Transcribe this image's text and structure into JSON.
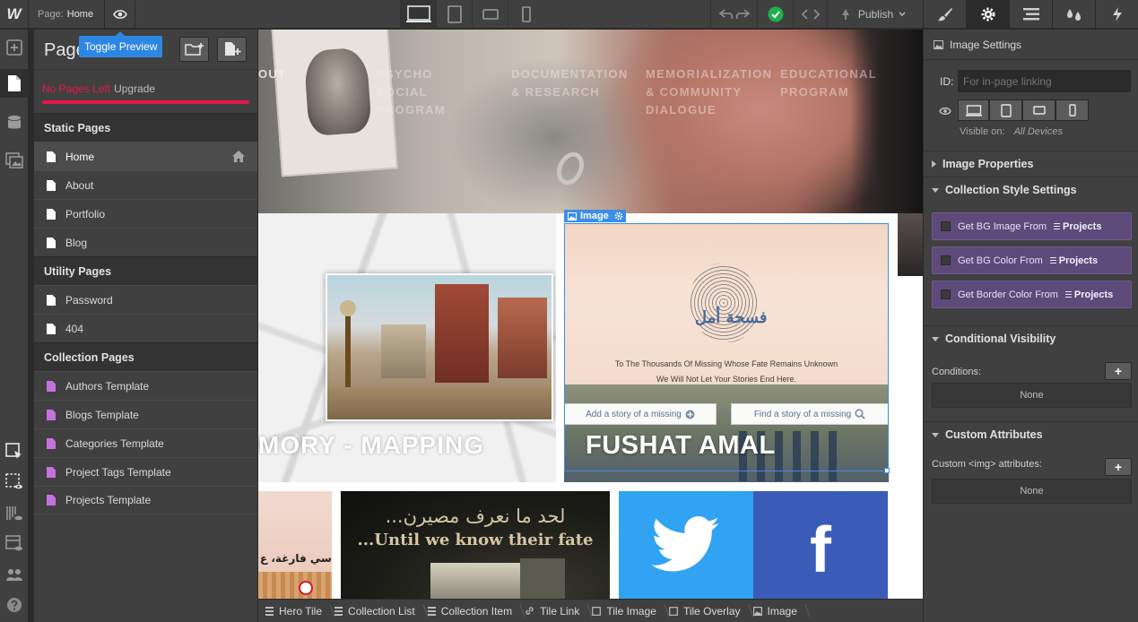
{
  "app": {
    "logo": "W",
    "page_label": "Page:",
    "page_name": "Home",
    "publish_label": "Publish",
    "tooltip": "Toggle Preview"
  },
  "pages_panel": {
    "title": "Pages",
    "limit_text": "No Pages Left",
    "upgrade": "Upgrade",
    "sections": [
      {
        "title": "Static Pages",
        "items": [
          "Home",
          "About",
          "Portfolio",
          "Blog"
        ]
      },
      {
        "title": "Utility Pages",
        "items": [
          "Password",
          "404"
        ]
      },
      {
        "title": "Collection Pages",
        "items": [
          "Authors Template",
          "Blogs Template",
          "Categories Template",
          "Project Tags Template",
          "Projects Template"
        ]
      }
    ]
  },
  "canvas": {
    "nav": [
      "OUT",
      "PSYCHO",
      "SOCIAL",
      "PROGRAM",
      "DOCUMENTATION",
      "& RESEARCH",
      "MEMORIALIZATION",
      "& COMMUNITY",
      "DIALOGUE",
      "EDUCATIONAL",
      "PROGRAM"
    ],
    "tile_mapping_title": "MORY - MAPPING",
    "tile_amal_title": "FUSHAT AMAL",
    "amal_calligraphy": "فسحة أمل",
    "amal_line1": "To The Thousands Of Missing Whose Fate Remains Unknown",
    "amal_line2": "We Will Not Let Your Stories End Here.",
    "amal_add": "Add a story of a missing",
    "amal_find": "Find a story of a missing",
    "chairs_text": "كراسي فارغة، ع",
    "fate_ar": "...لحد ما نعرف مصيرن",
    "fate_en": "...Until we know their fate",
    "selection_label": "Image"
  },
  "breadcrumbs": [
    "Hero Tile",
    "Collection List",
    "Collection Item",
    "Tile Link",
    "Tile Image",
    "Tile Overlay",
    "Image"
  ],
  "right_panel": {
    "header": "Image Settings",
    "id_label": "ID:",
    "id_placeholder": "For in-page linking",
    "visible_on_label": "Visible on:",
    "visible_on_value": "All Devices",
    "image_properties": "Image Properties",
    "collection_style": "Collection Style Settings",
    "coll_items": [
      {
        "label": "Get BG Image From",
        "collection": "Projects"
      },
      {
        "label": "Get BG Color From",
        "collection": "Projects"
      },
      {
        "label": "Get Border Color From",
        "collection": "Projects"
      }
    ],
    "conditional_visibility": "Conditional Visibility",
    "conditions_label": "Conditions:",
    "conditions_value": "None",
    "custom_attributes": "Custom Attributes",
    "custom_attr_label": "Custom <img> attributes:",
    "custom_attr_value": "None"
  },
  "colors": {
    "accent_blue": "#2d87e2",
    "limit_red": "#e5164a",
    "collection_purple": "#5d4a7b",
    "check_green": "#1eb049"
  }
}
